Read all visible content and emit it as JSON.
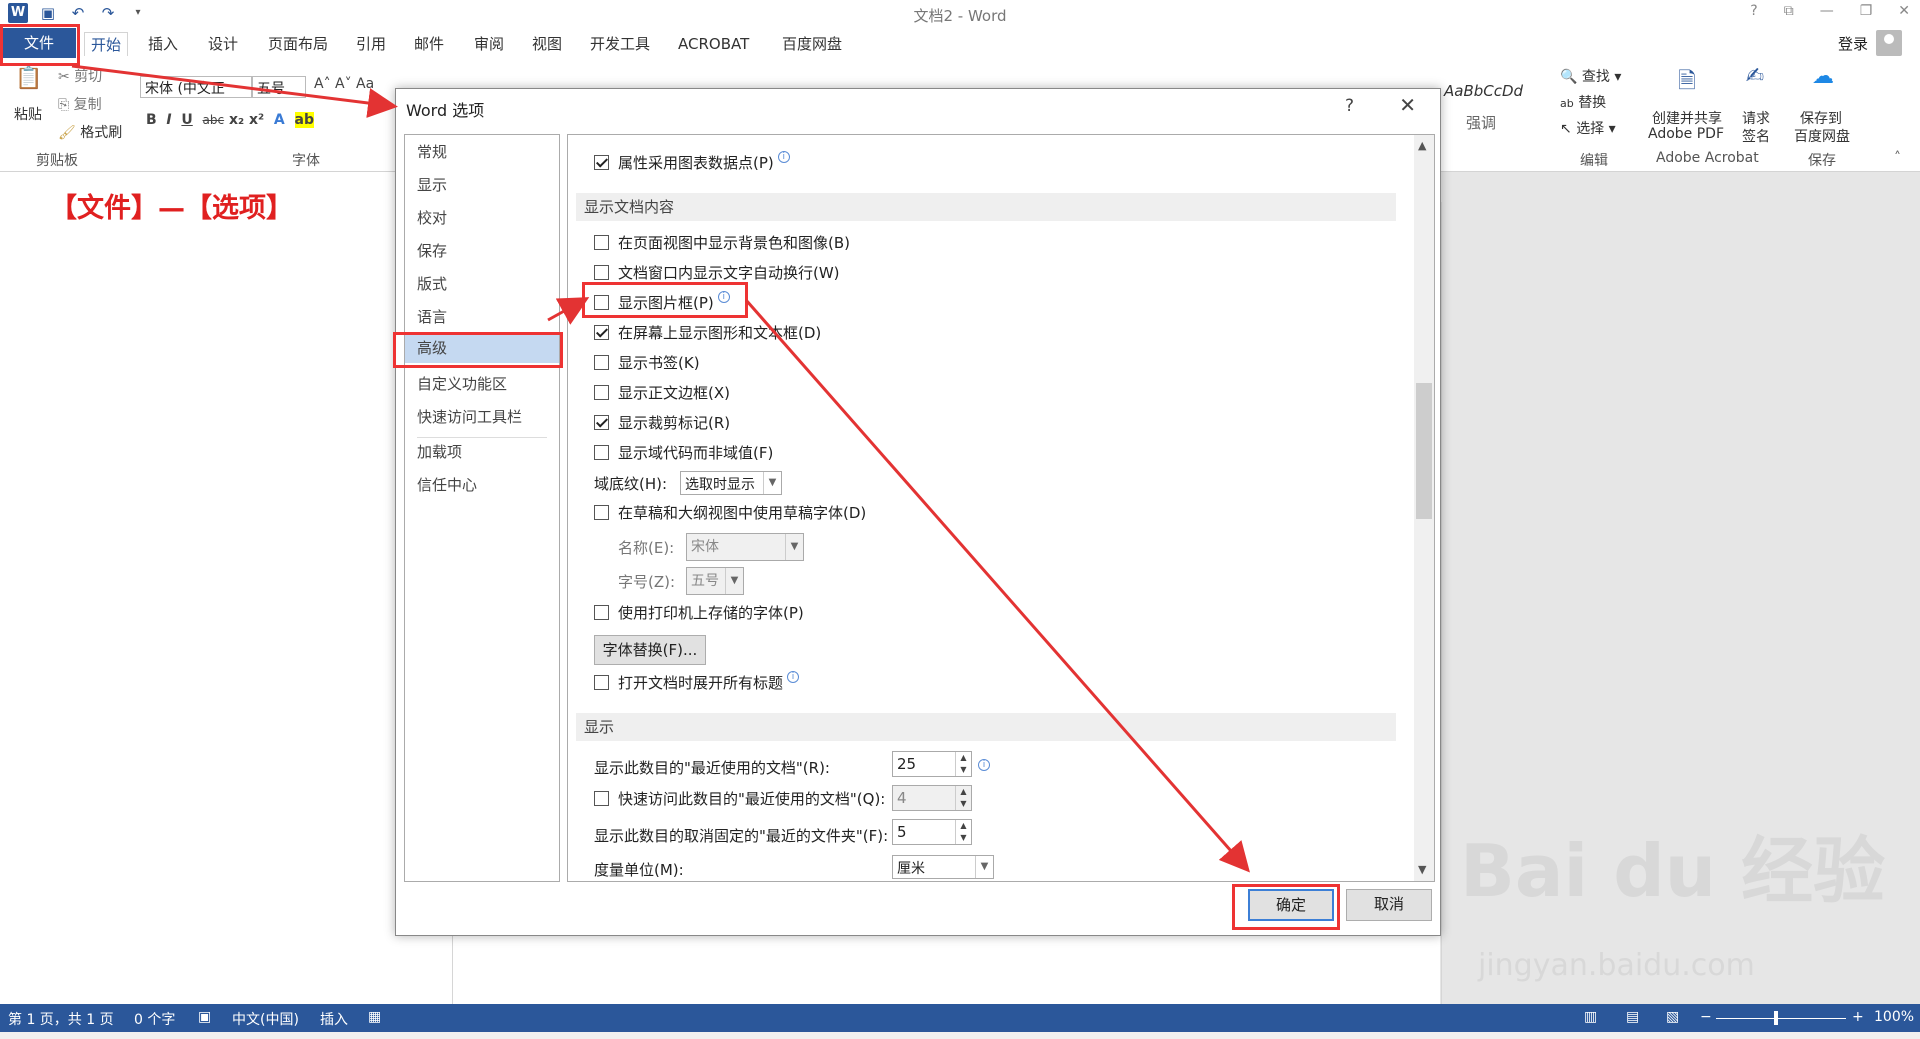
{
  "window": {
    "title": "文档2 - Word",
    "help_icon": "?",
    "sign_in": "登录"
  },
  "tabs": {
    "file": "文件",
    "home": "开始",
    "insert": "插入",
    "design": "设计",
    "layout": "页面布局",
    "references": "引用",
    "mailings": "邮件",
    "review": "审阅",
    "view": "视图",
    "developer": "开发工具",
    "acrobat": "ACROBAT",
    "baidu": "百度网盘"
  },
  "ribbon": {
    "paste": "粘贴",
    "cut": "剪切",
    "copy": "复制",
    "format_painter": "格式刷",
    "clipboard_label": "剪贴板",
    "font_name": "宋体 (中文正",
    "font_size": "五号",
    "font_label": "字体",
    "style_sample": "AaBbCcDd",
    "style_name": "强调",
    "find": "查找",
    "replace": "替换",
    "select": "选择",
    "edit_label": "编辑",
    "create_pdf": "创建并共享",
    "adobe_pdf": "Adobe PDF",
    "request_sign": "请求",
    "sign": "签名",
    "acrobat_label": "Adobe Acrobat",
    "save_to": "保存到",
    "baidu_pan": "百度网盘",
    "save_label": "保存"
  },
  "annotation": "【文件】—【选项】",
  "dialog": {
    "title": "Word 选项",
    "help": "?",
    "nav": [
      "常规",
      "显示",
      "校对",
      "保存",
      "版式",
      "语言",
      "高级",
      "自定义功能区",
      "快速访问工具栏",
      "加载项",
      "信任中心"
    ],
    "selected_nav": "高级",
    "chart_points_option": "属性采用图表数据点(P)",
    "section_show_doc": "显示文档内容",
    "options": [
      {
        "label": "在页面视图中显示背景色和图像(B)",
        "checked": false
      },
      {
        "label": "文档窗口内显示文字自动换行(W)",
        "checked": false
      },
      {
        "label": "显示图片框(P)",
        "checked": false
      },
      {
        "label": "在屏幕上显示图形和文本框(D)",
        "checked": true
      },
      {
        "label": "显示书签(K)",
        "checked": false
      },
      {
        "label": "显示正文边框(X)",
        "checked": false
      },
      {
        "label": "显示裁剪标记(R)",
        "checked": true
      },
      {
        "label": "显示域代码而非域值(F)",
        "checked": false
      }
    ],
    "field_shading_label": "域底纹(H):",
    "field_shading_value": "选取时显示",
    "draft_font_option": "在草稿和大纲视图中使用草稿字体(D)",
    "name_label": "名称(E):",
    "name_value": "宋体",
    "size_label": "字号(Z):",
    "size_value": "五号",
    "printer_fonts_option": "使用打印机上存储的字体(P)",
    "font_substitution_button": "字体替换(F)...",
    "expand_headings_option": "打开文档时展开所有标题",
    "section_display": "显示",
    "recent_docs_label": "显示此数目的\"最近使用的文档\"(R):",
    "recent_docs_value": "25",
    "quick_access_label": "快速访问此数目的\"最近使用的文档\"(Q):",
    "quick_access_value": "4",
    "unpinned_folders_label": "显示此数目的取消固定的\"最近的文件夹\"(F):",
    "unpinned_folders_value": "5",
    "units_label": "度量单位(M):",
    "units_value": "厘米",
    "ok": "确定",
    "cancel": "取消"
  },
  "status": {
    "page": "第 1 页，共 1 页",
    "words": "0 个字",
    "language": "中文(中国)",
    "mode": "插入",
    "zoom": "100%"
  },
  "watermark": {
    "brand": "Bai du 经验",
    "url": "jingyan.baidu.com"
  },
  "colors": {
    "word_blue": "#2b579a",
    "highlight_red": "#e33333",
    "nav_selected": "#c5d9f1"
  }
}
